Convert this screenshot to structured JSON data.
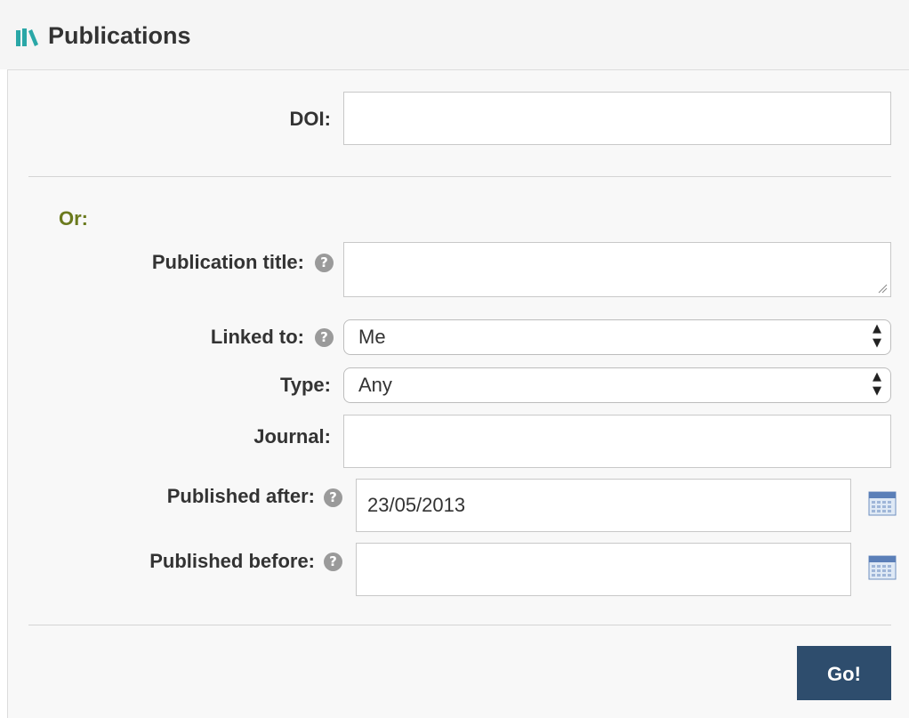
{
  "panel": {
    "title": "Publications",
    "icon": "books-icon",
    "accent_color": "#2aa7a7"
  },
  "form": {
    "doi": {
      "label": "DOI:",
      "value": ""
    },
    "or_label": "Or:",
    "or_color": "#6b7a1e",
    "publication_title": {
      "label": "Publication title:",
      "value": ""
    },
    "linked_to": {
      "label": "Linked to:",
      "value": "Me"
    },
    "type": {
      "label": "Type:",
      "value": "Any"
    },
    "journal": {
      "label": "Journal:",
      "value": ""
    },
    "published_after": {
      "label": "Published after:",
      "value": "23/05/2013"
    },
    "published_before": {
      "label": "Published before:",
      "value": ""
    },
    "help_icon": "?",
    "submit_label": "Go!",
    "submit_color": "#2e4d6d"
  }
}
